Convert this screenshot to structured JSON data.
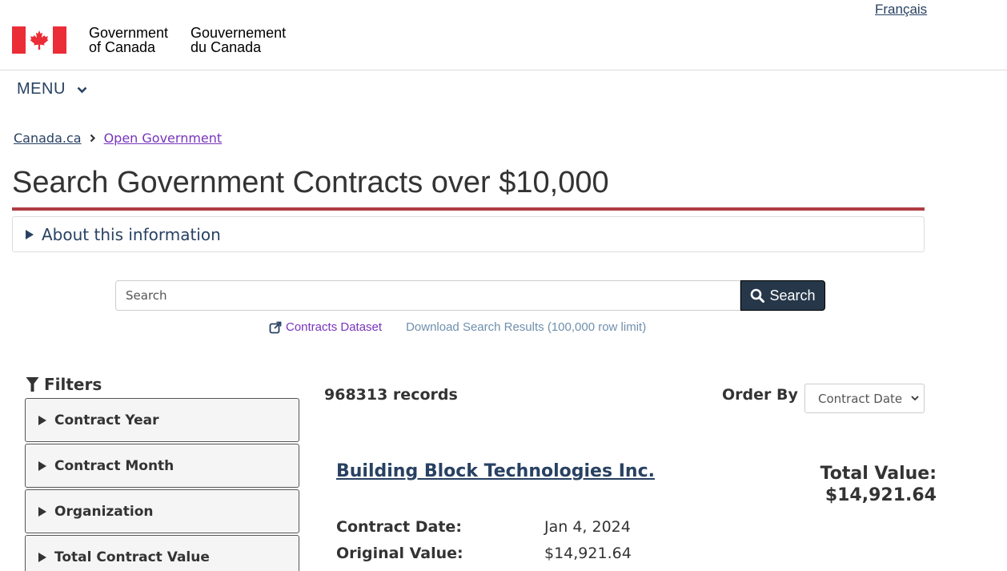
{
  "header": {
    "language_link": "Français",
    "wordmark_en": [
      "Government",
      "of Canada"
    ],
    "wordmark_fr": [
      "Gouvernement",
      "du Canada"
    ],
    "flag_colors": {
      "red": "#eb2d37",
      "white": "#ffffff"
    }
  },
  "menu": {
    "label": "MENU",
    "icon": "chevron-down-icon"
  },
  "breadcrumb": {
    "items": [
      "Canada.ca",
      "Open Government"
    ]
  },
  "page": {
    "title": "Search Government Contracts over $10,000",
    "accent_color": "#af3c43"
  },
  "about": {
    "label": "About this information"
  },
  "search": {
    "placeholder": "Search",
    "button_label": "Search"
  },
  "links": {
    "dataset": "Contracts Dataset",
    "download": "Download Search Results (100,000 row limit)"
  },
  "filters": {
    "heading": "Filters",
    "items": [
      "Contract Year",
      "Contract Month",
      "Organization",
      "Total Contract Value"
    ]
  },
  "results": {
    "count_text": "968313 records",
    "order_by_label": "Order By",
    "order_by_value": "Contract Date",
    "first": {
      "vendor": "Building Block Technologies Inc.",
      "total_label": "Total Value:",
      "total_value": "$14,921.64",
      "contract_date_label": "Contract Date:",
      "contract_date": "Jan 4, 2024",
      "original_value_label": "Original Value:",
      "original_value": "$14,921.64"
    }
  }
}
